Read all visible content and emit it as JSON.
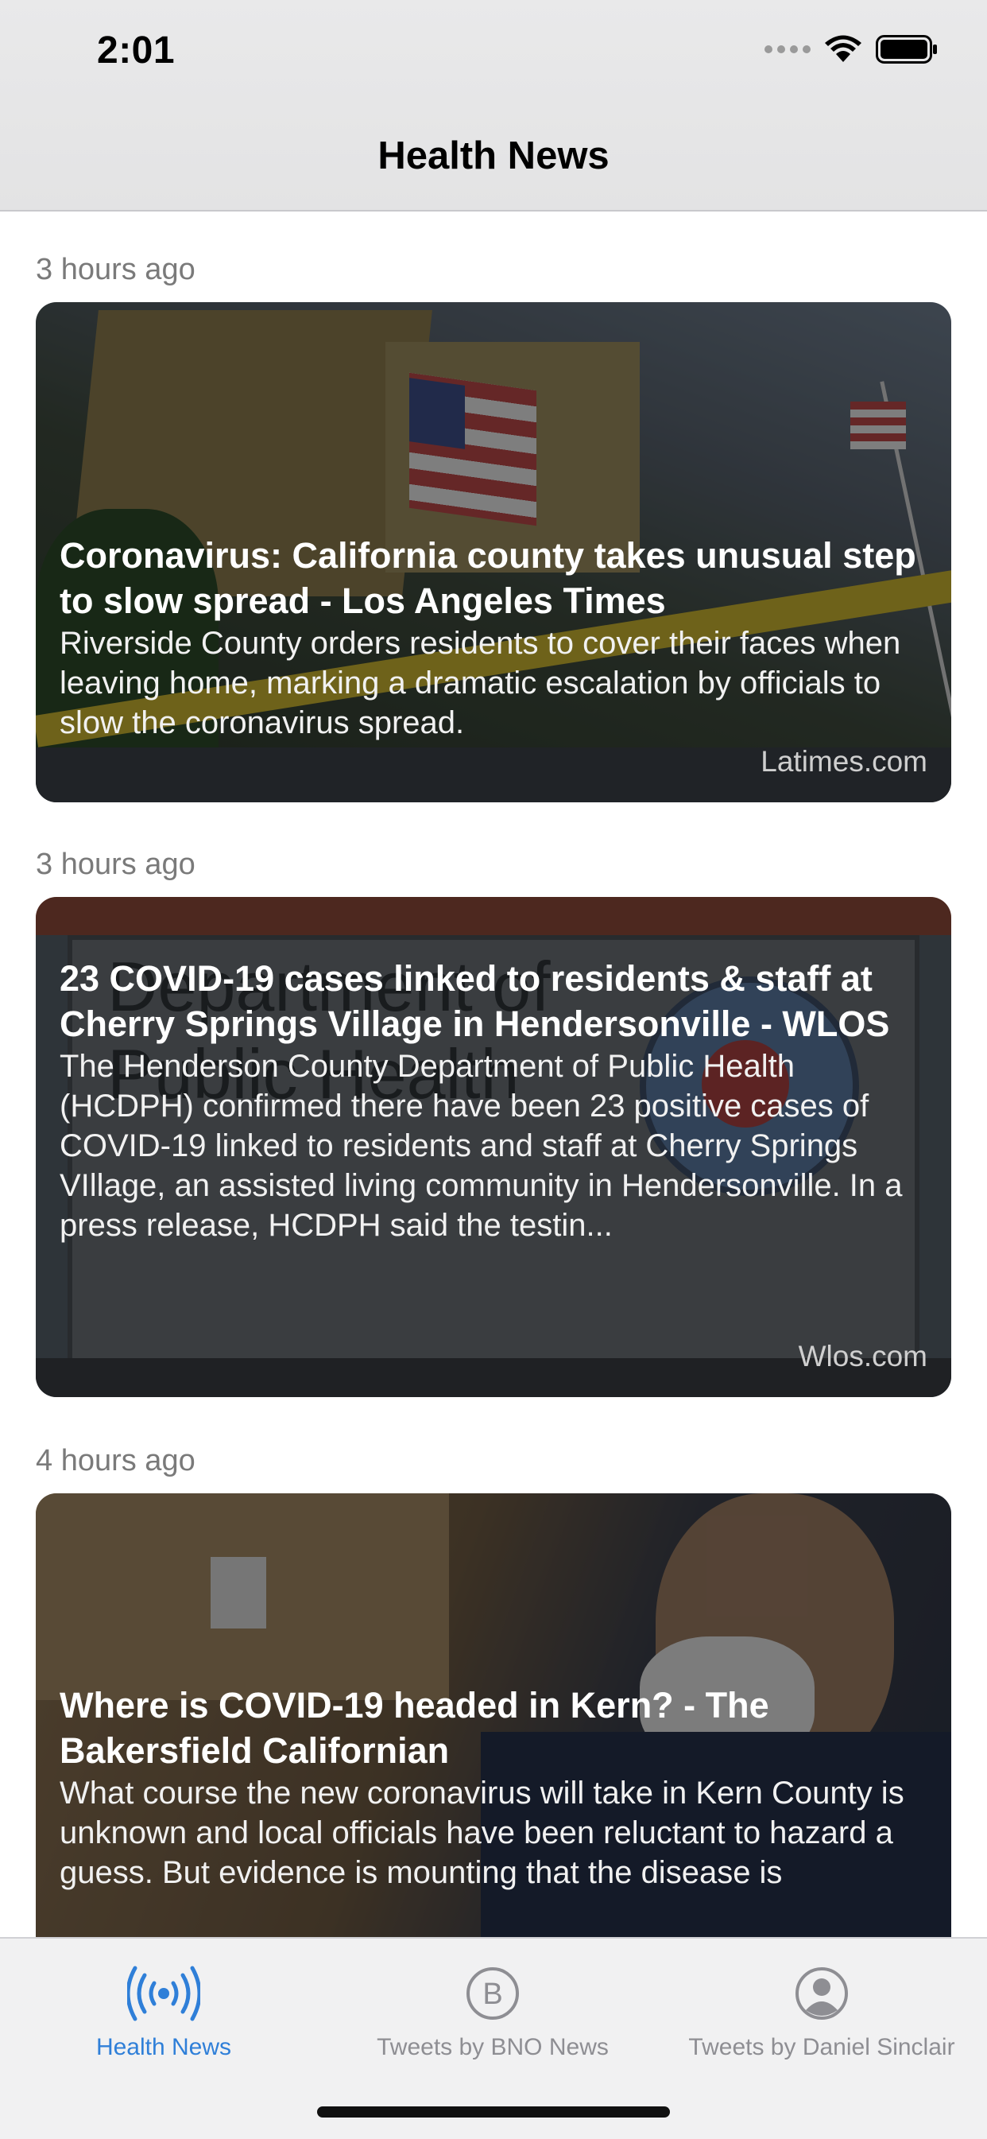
{
  "status_bar": {
    "time": "2:01"
  },
  "nav": {
    "title": "Health News"
  },
  "articles": [
    {
      "timestamp": "3 hours ago",
      "headline": "Coronavirus: California county takes unusual step to slow spread - Los Angeles Times",
      "summary": "Riverside County orders residents to cover their faces when leaving home, marking a dramatic escalation by officials to slow the coronavirus spread.",
      "source": "Latimes.com"
    },
    {
      "timestamp": "3 hours ago",
      "headline": "23 COVID-19 cases linked to residents & staff at Cherry Springs Village in Hendersonville - WLOS",
      "summary": "The Henderson County Department of Public Health (HCDPH) confirmed there have been 23 positive cases of COVID-19 linked to residents and staff at Cherry Springs VIllage, an assisted living community in Hendersonville. In a press release, HCDPH said the testin...",
      "source": "Wlos.com",
      "image_text": "Department of Public Health"
    },
    {
      "timestamp": "4 hours ago",
      "headline": "Where is COVID-19 headed in Kern? - The Bakersfield Californian",
      "summary": "What course the new coronavirus will take in Kern County is unknown and local officials have been reluctant to hazard a guess. But evidence is mounting that the disease is",
      "source": ""
    }
  ],
  "tabbar": {
    "tabs": [
      {
        "label": "Health News",
        "icon": "broadcast-icon",
        "active": true
      },
      {
        "label": "Tweets by BNO News",
        "icon": "letter-b-circle-icon",
        "active": false
      },
      {
        "label": "Tweets by Daniel Sinclair",
        "icon": "person-circle-icon",
        "active": false
      }
    ]
  },
  "colors": {
    "accent": "#2f7fd8",
    "inactive": "#8e8e93"
  }
}
